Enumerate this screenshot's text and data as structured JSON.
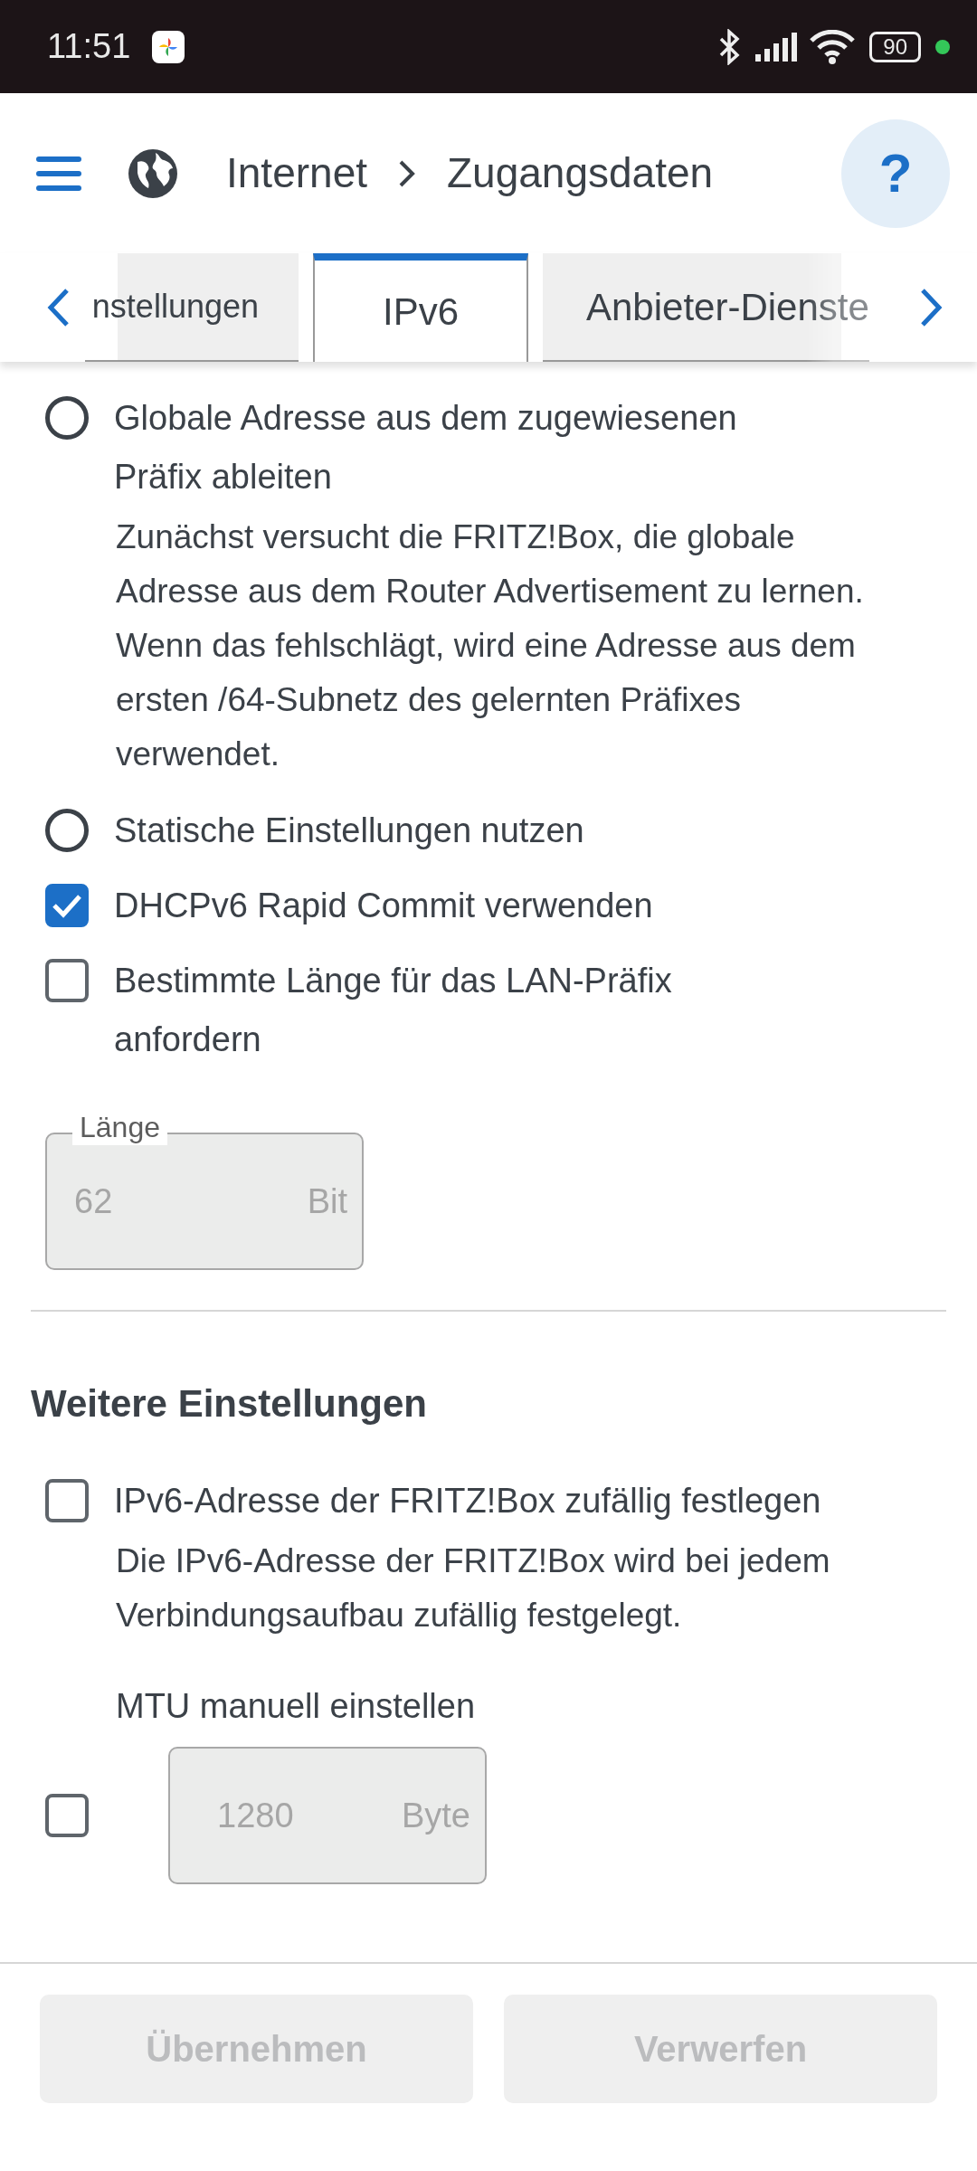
{
  "status_bar": {
    "time": "11:51",
    "battery": "90"
  },
  "header": {
    "breadcrumb": [
      "Internet",
      "Zugangsdaten"
    ],
    "help": "?"
  },
  "tabs": [
    {
      "label": "nstellungen",
      "selected": false
    },
    {
      "label": "IPv6",
      "selected": true
    },
    {
      "label": "Anbieter-Dienste",
      "selected": false
    }
  ],
  "options": [
    {
      "kind": "radio",
      "label": "Globale Adresse aus dem zugewiesenen Präfix ableiten",
      "selected": false,
      "description": "Zunächst versucht die FRITZ!Box, die globale Adresse aus dem Router Advertisement zu lernen. Wenn das fehlschlägt, wird eine Adresse aus dem ersten /64-Subnetz des gelernten Präfixes verwendet."
    },
    {
      "kind": "radio",
      "label": "Statische Einstellungen nutzen",
      "selected": false
    },
    {
      "kind": "checkbox",
      "label": "DHCPv6 Rapid Commit verwenden",
      "checked": true
    },
    {
      "kind": "checkbox",
      "label": "Bestimmte Länge für das LAN-Präfix anfordern",
      "checked": false
    }
  ],
  "length_field": {
    "label": "Länge",
    "value": "62",
    "unit": "Bit",
    "disabled": true
  },
  "further": {
    "heading": "Weitere Einstellungen",
    "options": [
      {
        "kind": "checkbox",
        "label": "IPv6-Adresse der FRITZ!Box zufällig festlegen",
        "checked": false,
        "description": "Die IPv6-Adresse der FRITZ!Box wird bei jedem Verbindungsaufbau zufällig festgelegt."
      }
    ],
    "mtu": {
      "label": "MTU manuell einstellen",
      "checked": false,
      "value": "1280",
      "unit": "Byte",
      "disabled": true
    }
  },
  "buttons": [
    {
      "label": "Übernehmen",
      "disabled": true
    },
    {
      "label": "Verwerfen",
      "disabled": true
    }
  ]
}
